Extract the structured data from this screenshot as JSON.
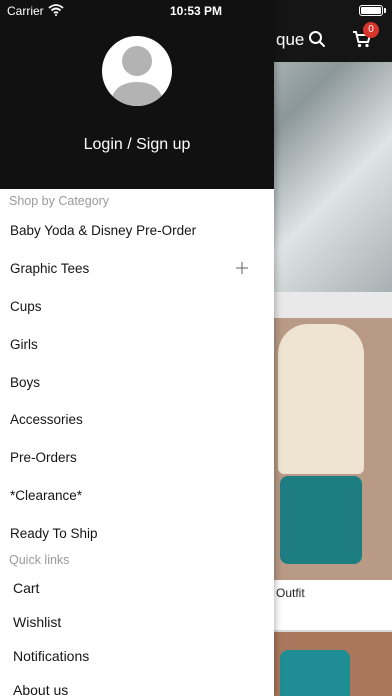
{
  "status_bar": {
    "carrier": "Carrier",
    "time": "10:53 PM",
    "battery_level": 1.0
  },
  "background": {
    "header_title_fragment": "que",
    "cart_count": "0",
    "product_caption": "Outfit",
    "icons": [
      "search-icon",
      "cart-icon"
    ]
  },
  "drawer": {
    "login_label": "Login / Sign up",
    "shop_by_category_label": "Shop by Category",
    "categories": [
      {
        "label": "Baby Yoda & Disney Pre-Order"
      },
      {
        "label": "Graphic Tees",
        "expandable": true
      },
      {
        "label": "Cups"
      },
      {
        "label": "Girls"
      },
      {
        "label": "Boys"
      },
      {
        "label": "Accessories"
      },
      {
        "label": "Pre-Orders"
      },
      {
        "label": "*Clearance*"
      },
      {
        "label": "Ready To Ship"
      }
    ],
    "quick_links_label": "Quick links",
    "quick_links": [
      {
        "label": "Cart"
      },
      {
        "label": "Wishlist"
      },
      {
        "label": "Notifications"
      },
      {
        "label": "About us"
      }
    ]
  },
  "colors": {
    "drawer_header": "#111111",
    "section_label": "#9a9a9a",
    "badge": "#d9342b"
  }
}
